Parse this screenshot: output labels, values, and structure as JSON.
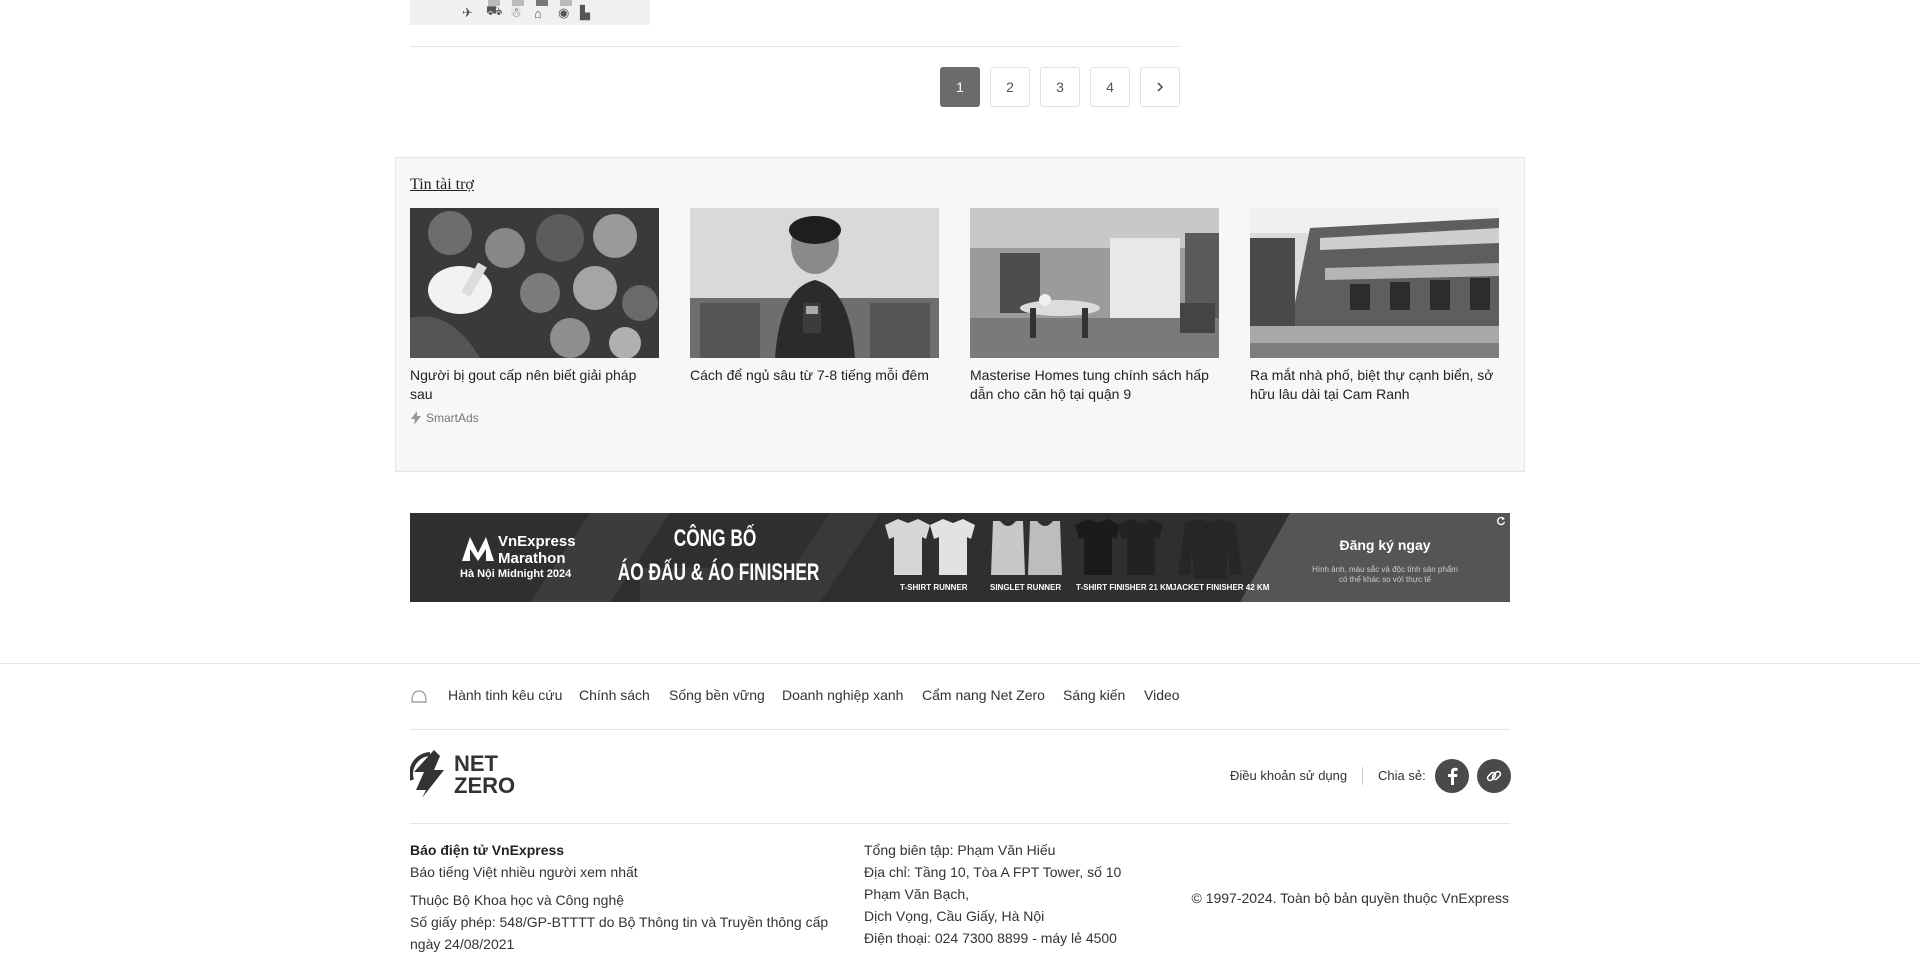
{
  "pagination": {
    "pages": [
      "1",
      "2",
      "3",
      "4"
    ],
    "active": "1",
    "next_icon": "chevron-right-icon"
  },
  "sponsored": {
    "title": "Tin tài trợ",
    "cards": [
      {
        "title": "Người bị gout cấp nên biết giải pháp sau"
      },
      {
        "title": "Cách để ngủ sâu từ 7-8 tiếng mỗi đêm"
      },
      {
        "title": "Masterise Homes tung chính sách hấp dẫn cho căn hộ tại quận 9"
      },
      {
        "title": "Ra mắt nhà phố, biệt thự cạnh biển, sở hữu lâu dài tại Cam Ranh"
      }
    ],
    "provider": "SmartAds"
  },
  "banner": {
    "brand_line1": "VnExpress",
    "brand_line2": "Marathon",
    "brand_line3": "Hà Nội Midnight 2024",
    "headline1": "CÔNG BỐ",
    "headline2": "ÁO ĐẤU & ÁO FINISHER",
    "shirts": [
      {
        "label": "T-SHIRT",
        "label2": "RUNNER"
      },
      {
        "label": "SINGLET",
        "label2": "RUNNER"
      },
      {
        "label": "T-SHIRT FINISHER",
        "label2": "21 KM"
      },
      {
        "label": "JACKET FINISHER",
        "label2": "42 KM"
      }
    ],
    "cta": "Đăng ký ngay",
    "disclaimer1": "Hình ảnh, màu sắc và độc tính sản phẩm",
    "disclaimer2": "có thể khác so với thực tế"
  },
  "footer": {
    "nav": [
      "Hành tinh kêu cứu",
      "Chính sách",
      "Sống bền vững",
      "Doanh nghiệp xanh",
      "Cẩm nang Net Zero",
      "Sáng kiến",
      "Video"
    ],
    "logo_line1": "NET",
    "logo_line2": "ZERO",
    "terms": "Điều khoản sử dụng",
    "share_label": "Chia sẻ:",
    "col1": {
      "name": "Báo điện tử VnExpress",
      "tagline": "Báo tiếng Việt nhiều người xem nhất",
      "owner": "Thuộc Bộ Khoa học và Công nghệ",
      "license": "Số giấy phép: 548/GP-BTTTT do Bộ Thông tin và Truyền thông cấp ngày 24/08/2021"
    },
    "col2": {
      "editor": "Tổng biên tập: Phạm Văn Hiếu",
      "address": "Địa chỉ: Tầng 10, Tòa A FPT Tower, số 10 Phạm Văn Bạch,",
      "address2": "Dịch Vọng, Cầu Giấy, Hà Nội",
      "phone": "Điện thoại: 024 7300 8899 - máy lẻ 4500"
    },
    "copyright": "© 1997-2024. Toàn bộ bản quyền thuộc VnExpress"
  }
}
